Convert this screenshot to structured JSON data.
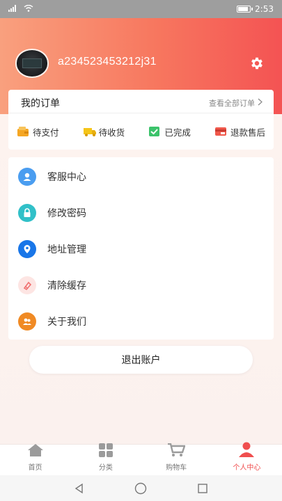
{
  "status_bar": {
    "time": "2:53",
    "signal": "4G",
    "battery_level": 0.9
  },
  "profile": {
    "username": "a234523453212j31"
  },
  "orders": {
    "title": "我的订单",
    "view_all": "查看全部订单",
    "items": [
      {
        "label": "待支付",
        "icon": "wallet-icon",
        "color": "#f5a623"
      },
      {
        "label": "待收货",
        "icon": "truck-icon",
        "color": "#f5c518"
      },
      {
        "label": "已完成",
        "icon": "check-icon",
        "color": "#3cc36b"
      },
      {
        "label": "退款售后",
        "icon": "refund-icon",
        "color": "#f0584b"
      }
    ]
  },
  "menu": {
    "items": [
      {
        "label": "客服中心",
        "icon": "service-icon",
        "color": "#4a9df0"
      },
      {
        "label": "修改密码",
        "icon": "lock-icon",
        "color": "#31c0c8"
      },
      {
        "label": "地址管理",
        "icon": "location-icon",
        "color": "#1976e8"
      },
      {
        "label": "清除缓存",
        "icon": "clean-icon",
        "color": "#f07070"
      },
      {
        "label": "关于我们",
        "icon": "about-icon",
        "color": "#f08a24"
      }
    ]
  },
  "logout": {
    "label": "退出账户"
  },
  "tabbar": {
    "items": [
      {
        "label": "首页",
        "icon": "home-icon",
        "active": false
      },
      {
        "label": "分类",
        "icon": "category-icon",
        "active": false
      },
      {
        "label": "购物车",
        "icon": "cart-icon",
        "active": false
      },
      {
        "label": "个人中心",
        "icon": "user-icon",
        "active": true
      }
    ],
    "active_color": "#f04e4e",
    "inactive_color": "#999999"
  },
  "accent": "#f45353"
}
